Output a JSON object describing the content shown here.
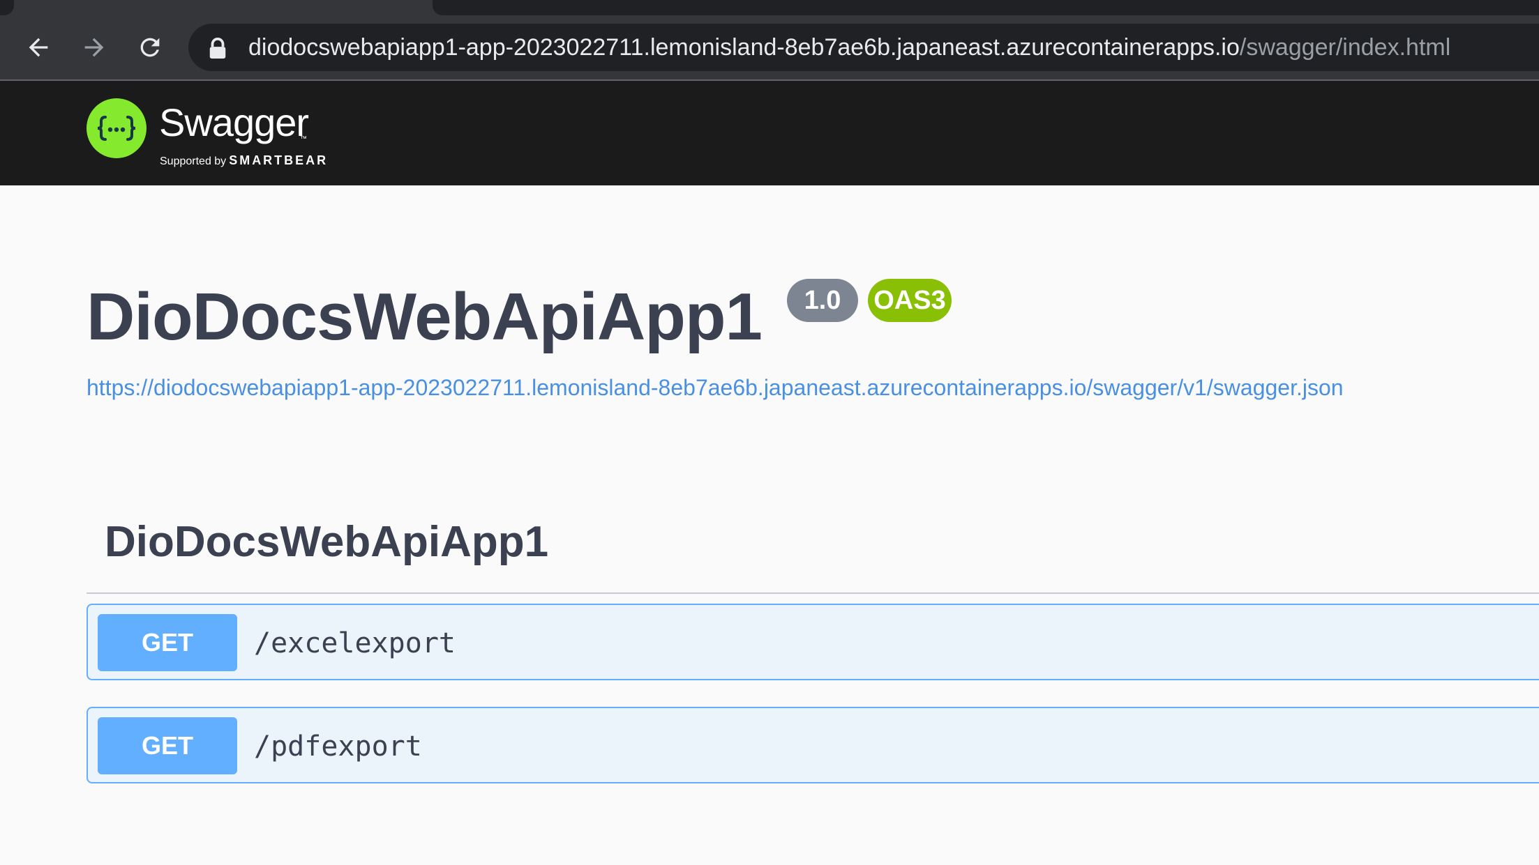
{
  "browser": {
    "url_host": "diodocswebapiapp1-app-2023022711.lemonisland-8eb7ae6b.japaneast.azurecontainerapps.io",
    "url_path": "/swagger/index.html",
    "icons": [
      "back-icon",
      "forward-icon",
      "reload-icon",
      "lock-icon"
    ]
  },
  "topbar": {
    "logo_text": "Swagger",
    "logo_tm": "™",
    "supported_by": "Supported by",
    "smartbear": "SMARTBEAR",
    "background": "#1b1b1b",
    "logo_color": "#85ea2d"
  },
  "info": {
    "title": "DioDocsWebApiApp1",
    "version": "1.0",
    "oas_badge": "OAS3",
    "spec_url": "https://diodocswebapiapp1-app-2023022711.lemonisland-8eb7ae6b.japaneast.azurecontainerapps.io/swagger/v1/swagger.json"
  },
  "tag": {
    "name": "DioDocsWebApiApp1"
  },
  "operations": [
    {
      "method": "GET",
      "path": "/excelexport"
    },
    {
      "method": "GET",
      "path": "/pdfexport"
    }
  ],
  "colors": {
    "get_method": "#61affe",
    "text_primary": "#3b4151",
    "link": "#4990e2",
    "version_badge": "#7d8492",
    "oas_badge": "#89bf04"
  }
}
